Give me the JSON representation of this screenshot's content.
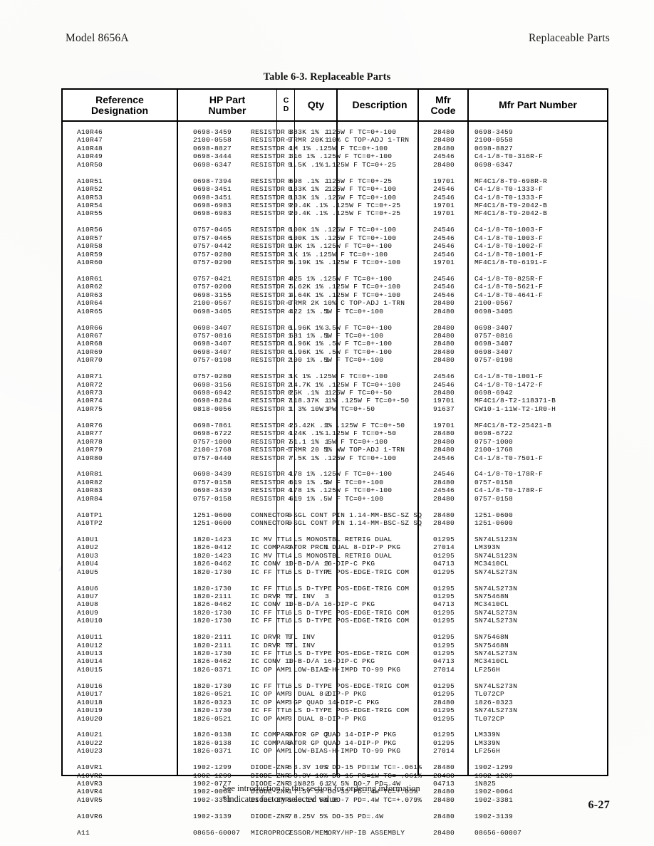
{
  "header": {
    "left": "Model 8656A",
    "right": "Replaceable Parts"
  },
  "caption": "Table 6-3. Replaceable Parts",
  "columns": {
    "reference": "Reference\nDesignation",
    "hp_part": "HP Part\nNumber",
    "cd": "C\nD",
    "qty": "Qty",
    "description": "Description",
    "mfr_code": "Mfr\nCode",
    "mfr_part": "Mfr Part Number"
  },
  "footnote": {
    "line1": "See introduction to this section for ordering information",
    "line2": "*Indicates factory selected value"
  },
  "page_number": "6-27",
  "watermark": "manualslib.com",
  "groups": [
    {
      "rows": [
        {
          "ref": "A10R46",
          "hp": "0698-3459",
          "cd": "8",
          "qty": "1",
          "desc": "RESISTOR 383K 1% .125W F TC=0+-100",
          "mfr": "28480",
          "mpn": "0698-3459"
        },
        {
          "ref": "A10R47",
          "hp": "2100-0558",
          "cd": "9",
          "qty": "1",
          "desc": "RESISTOR-TRMR 20K 10% C TOP-ADJ 1-TRN",
          "mfr": "28480",
          "mpn": "2100-0558"
        },
        {
          "ref": "A10R48",
          "hp": "0698-8827",
          "cd": "4",
          "qty": "",
          "desc": "RESISTOR 1M 1% .125W F TC=0+-100",
          "mfr": "28480",
          "mpn": "0698-8827"
        },
        {
          "ref": "A10R49",
          "hp": "0698-3444",
          "cd": "1",
          "qty": "",
          "desc": "RESISTOR 316 1% .125W F TC=0+-100",
          "mfr": "24546",
          "mpn": "C4-1/8-T0-316R-F"
        },
        {
          "ref": "A10R50",
          "hp": "0698-6347",
          "cd": "9",
          "qty": "1",
          "desc": "RESISTOR 1.5K .1% .125W F TC=0+-25",
          "mfr": "28480",
          "mpn": "0698-6347"
        }
      ]
    },
    {
      "rows": [
        {
          "ref": "A10R51",
          "hp": "0698-7394",
          "cd": "8",
          "qty": "1",
          "desc": "RESISTOR 698 .1% .125W F TC=0+-25",
          "mfr": "19701",
          "mpn": "MF4C1/8-T9-698R-R"
        },
        {
          "ref": "A10R52",
          "hp": "0698-3451",
          "cd": "0",
          "qty": "2",
          "desc": "RESISTOR 133K 1% .125W F TC=0+-100",
          "mfr": "24546",
          "mpn": "C4-1/8-T0-1333-F"
        },
        {
          "ref": "A10R53",
          "hp": "0698-3451",
          "cd": "0",
          "qty": "",
          "desc": "RESISTOR 133K 1% .125W F TC=0+-100",
          "mfr": "24546",
          "mpn": "C4-1/8-T0-1333-F"
        },
        {
          "ref": "A10R54",
          "hp": "0698-6983",
          "cd": "9",
          "qty": "",
          "desc": "RESISTOR 20.4K .1% .125W F TC=0+-25",
          "mfr": "19701",
          "mpn": "MF4C1/8-T9-2042-B"
        },
        {
          "ref": "A10R55",
          "hp": "0698-6983",
          "cd": "9",
          "qty": "",
          "desc": "RESISTOR 20.4K .1% .125W F TC=0+-25",
          "mfr": "19701",
          "mpn": "MF4C1/8-T9-2042-B"
        }
      ]
    },
    {
      "rows": [
        {
          "ref": "A10R56",
          "hp": "0757-0465",
          "cd": "6",
          "qty": "",
          "desc": "RESISTOR 100K 1% .125W F TC=0+-100",
          "mfr": "24546",
          "mpn": "C4-1/8-T0-1003-F"
        },
        {
          "ref": "A10R57",
          "hp": "0757-0465",
          "cd": "6",
          "qty": "",
          "desc": "RESISTOR 100K 1% .125W F TC=0+-100",
          "mfr": "24546",
          "mpn": "C4-1/8-T0-1003-F"
        },
        {
          "ref": "A10R58",
          "hp": "0757-0442",
          "cd": "9",
          "qty": "",
          "desc": "RESISTOR 10K 1% .125W F TC=0+-100",
          "mfr": "24546",
          "mpn": "C4-1/8-T0-1002-F"
        },
        {
          "ref": "A10R59",
          "hp": "0757-0280",
          "cd": "3",
          "qty": "",
          "desc": "RESISTOR 1K 1% .125W F TC=0+-100",
          "mfr": "24546",
          "mpn": "C4-1/8-T0-1001-F"
        },
        {
          "ref": "A10R60",
          "hp": "0757-0290",
          "cd": "5",
          "qty": "",
          "desc": "RESISTOR 6.19K 1% .125W F TC=0+-100",
          "mfr": "19701",
          "mpn": "MF4C1/8-T0-6191-F"
        }
      ]
    },
    {
      "rows": [
        {
          "ref": "A10R61",
          "hp": "0757-0421",
          "cd": "4",
          "qty": "",
          "desc": "RESISTOR 825 1% .125W F TC=0+-100",
          "mfr": "24546",
          "mpn": "C4-1/8-T0-825R-F"
        },
        {
          "ref": "A10R62",
          "hp": "0757-0200",
          "cd": "7",
          "qty": "",
          "desc": "RESISTOR 5.62K 1% .125W F TC=0+-100",
          "mfr": "24546",
          "mpn": "C4-1/8-T0-5621-F"
        },
        {
          "ref": "A10R63",
          "hp": "0698-3155",
          "cd": "1",
          "qty": "",
          "desc": "RESISTOR 4.64K 1% .125W F TC=0+-100",
          "mfr": "24546",
          "mpn": "C4-1/8-T0-4641-F"
        },
        {
          "ref": "A10R64",
          "hp": "2100-0567",
          "cd": "0",
          "qty": "",
          "desc": "RESISTOR-TRMR 2K 10% C TOP-ADJ 1-TRN",
          "mfr": "28480",
          "mpn": "2100-0567"
        },
        {
          "ref": "A10R65",
          "hp": "0698-3405",
          "cd": "4",
          "qty": "1",
          "desc": "RESISTOR 422 1% .5W F TC=0+-100",
          "mfr": "28480",
          "mpn": "0698-3405"
        }
      ]
    },
    {
      "rows": [
        {
          "ref": "A10R66",
          "hp": "0698-3407",
          "cd": "6",
          "qty": "3",
          "desc": "RESISTOR 1.96K 1% .5W F TC=0+-100",
          "mfr": "28480",
          "mpn": "0698-3407"
        },
        {
          "ref": "A10R67",
          "hp": "0757-0816",
          "cd": "1",
          "qty": "1",
          "desc": "RESISTOR 681 1% .5W F TC=0+-100",
          "mfr": "28480",
          "mpn": "0757-0816"
        },
        {
          "ref": "A10R68",
          "hp": "0698-3407",
          "cd": "6",
          "qty": "",
          "desc": "RESISTOR 1.96K 1% .5W F TC=0+-100",
          "mfr": "28480",
          "mpn": "0698-3407"
        },
        {
          "ref": "A10R69",
          "hp": "0698-3407",
          "cd": "6",
          "qty": "",
          "desc": "RESISTOR 1.96K 1% .5W F TC=0+-100",
          "mfr": "28480",
          "mpn": "0698-3407"
        },
        {
          "ref": "A10R70",
          "hp": "0757-0198",
          "cd": "2",
          "qty": "1",
          "desc": "RESISTOR 100 1% .5W F TC=0+-100",
          "mfr": "28480",
          "mpn": "0757-0198"
        }
      ]
    },
    {
      "rows": [
        {
          "ref": "A10R71",
          "hp": "0757-0280",
          "cd": "3",
          "qty": "",
          "desc": "RESISTOR 1K 1% .125W F TC=0+-100",
          "mfr": "24546",
          "mpn": "C4-1/8-T0-1001-F"
        },
        {
          "ref": "A10R72",
          "hp": "0698-3156",
          "cd": "2",
          "qty": "",
          "desc": "RESISTOR 14.7K 1% .125W F TC=0+-100",
          "mfr": "24546",
          "mpn": "C4-1/8-T0-1472-F"
        },
        {
          "ref": "A10R73",
          "hp": "0698-6942",
          "cd": "0",
          "qty": "1",
          "desc": "RESISTOR 25K .1% .125W F TC=0+-50",
          "mfr": "28480",
          "mpn": "0698-6942"
        },
        {
          "ref": "A10R74",
          "hp": "0698-8284",
          "cd": "7",
          "qty": "1",
          "desc": "RESISTOR 118.37K .1% .125W F TC=0+-50",
          "mfr": "19701",
          "mpn": "MF4C1/8-T2-118371-B"
        },
        {
          "ref": "A10R75",
          "hp": "0818-0056",
          "cd": "1",
          "qty": "1",
          "desc": "RESISTOR 1 3% 10W PW TC=0+-50",
          "mfr": "91637",
          "mpn": "CW10-1-11W-T2-1R0-H"
        }
      ]
    },
    {
      "rows": [
        {
          "ref": "A10R76",
          "hp": "0698-7861",
          "cd": "4",
          "qty": "1",
          "desc": "RESISTOR 25.42K .1% .125W F TC=0+-50",
          "mfr": "19701",
          "mpn": "MF4C1/8-T2-25421-B"
        },
        {
          "ref": "A10R77",
          "hp": "0698-6722",
          "cd": "4",
          "qty": "1",
          "desc": "RESISTOR 124K .1% .125W F TC=0+-50",
          "mfr": "28480",
          "mpn": "0698-6722"
        },
        {
          "ref": "A10R78",
          "hp": "0757-1000",
          "cd": "7",
          "qty": "1",
          "desc": "RESISTOR 51.1 1% .5W F TC=0+-100",
          "mfr": "28480",
          "mpn": "0757-1000"
        },
        {
          "ref": "A10R79",
          "hp": "2100-1768",
          "cd": "5",
          "qty": "1",
          "desc": "RESISTOR-TRMR 20 5% WW TOP-ADJ 1-TRN",
          "mfr": "28480",
          "mpn": "2100-1768"
        },
        {
          "ref": "A10R80",
          "hp": "0757-0440",
          "cd": "7",
          "qty": "",
          "desc": "RESISTOR 7.5K 1% .125W F TC=0+-100",
          "mfr": "24546",
          "mpn": "C4-1/8-T0-7501-F"
        }
      ]
    },
    {
      "rows": [
        {
          "ref": "A10R81",
          "hp": "0698-3439",
          "cd": "4",
          "qty": "",
          "desc": "RESISTOR 178 1% .125W F TC=0+-100",
          "mfr": "24546",
          "mpn": "C4-1/8-T0-178R-F"
        },
        {
          "ref": "A10R82",
          "hp": "0757-0158",
          "cd": "4",
          "qty": "2",
          "desc": "RESISTOR 619 1% .5W F TC=0+-100",
          "mfr": "28480",
          "mpn": "0757-0158"
        },
        {
          "ref": "A10R83",
          "hp": "0698-3439",
          "cd": "4",
          "qty": "",
          "desc": "RESISTOR 178 1% .125W F TC=0+-100",
          "mfr": "24546",
          "mpn": "C4-1/8-T0-178R-F"
        },
        {
          "ref": "A10R84",
          "hp": "0757-0158",
          "cd": "4",
          "qty": "",
          "desc": "RESISTOR 619 1% .5W F TC=0+-100",
          "mfr": "28480",
          "mpn": "0757-0158"
        }
      ]
    },
    {
      "rows": [
        {
          "ref": "A10TP1",
          "hp": "1251-0600",
          "cd": "0",
          "qty": "",
          "desc": "CONNECTOR-SGL CONT PIN 1.14-MM-BSC-SZ SQ",
          "mfr": "28480",
          "mpn": "1251-0600"
        },
        {
          "ref": "A10TP2",
          "hp": "1251-0600",
          "cd": "0",
          "qty": "",
          "desc": "CONNECTOR-SGL CONT PIN 1.14-MM-BSC-SZ SQ",
          "mfr": "28480",
          "mpn": "1251-0600"
        }
      ]
    },
    {
      "rows": [
        {
          "ref": "A10U1",
          "hp": "1820-1423",
          "cd": "4",
          "qty": "",
          "desc": "IC MV TTL LS MONOSTBL RETRIG DUAL",
          "mfr": "01295",
          "mpn": "SN74LS123N"
        },
        {
          "ref": "A10U2",
          "hp": "1826-0412",
          "cd": "1",
          "qty": "1",
          "desc": "IC COMPARATOR PRCN DUAL 8-DIP-P PKG",
          "mfr": "27014",
          "mpn": "LM393N"
        },
        {
          "ref": "A10U3",
          "hp": "1820-1423",
          "cd": "4",
          "qty": "",
          "desc": "IC MV TTL LS MONOSTBL RETRIG DUAL",
          "mfr": "01295",
          "mpn": "SN74LS123N"
        },
        {
          "ref": "A10U4",
          "hp": "1826-0462",
          "cd": "1",
          "qty": "3",
          "desc": "IC CONV 10-B-D/A 16-DIP-C PKG",
          "mfr": "04713",
          "mpn": "MC3410CL"
        },
        {
          "ref": "A10U5",
          "hp": "1820-1730",
          "cd": "6",
          "qty": "7",
          "desc": "IC FF TTL LS D-TYPE POS-EDGE-TRIG COM",
          "mfr": "01295",
          "mpn": "SN74LS273N"
        }
      ]
    },
    {
      "rows": [
        {
          "ref": "A10U6",
          "hp": "1820-1730",
          "cd": "6",
          "qty": "",
          "desc": "IC FF TTL LS D-TYPE POS-EDGE-TRIG COM",
          "mfr": "01295",
          "mpn": "SN74LS273N"
        },
        {
          "ref": "A10U7",
          "hp": "1820-2111",
          "cd": "9",
          "qty": "3",
          "desc": "IC DRVR TTL INV",
          "mfr": "01295",
          "mpn": "SN75468N"
        },
        {
          "ref": "A10U8",
          "hp": "1826-0462",
          "cd": "1",
          "qty": "",
          "desc": "IC CONV 10-B-D/A 16-DIP-C PKG",
          "mfr": "04713",
          "mpn": "MC3410CL"
        },
        {
          "ref": "A10U9",
          "hp": "1820-1730",
          "cd": "6",
          "qty": "",
          "desc": "IC FF TTL LS D-TYPE POS-EDGE-TRIG COM",
          "mfr": "01295",
          "mpn": "SN74LS273N"
        },
        {
          "ref": "A10U10",
          "hp": "1820-1730",
          "cd": "6",
          "qty": "",
          "desc": "IC FF TTL LS D-TYPE POS-EDGE-TRIG COM",
          "mfr": "01295",
          "mpn": "SN74LS273N"
        }
      ]
    },
    {
      "rows": [
        {
          "ref": "A10U11",
          "hp": "1820-2111",
          "cd": "9",
          "qty": "",
          "desc": "IC DRVR TTL INV",
          "mfr": "01295",
          "mpn": "SN75468N"
        },
        {
          "ref": "A10U12",
          "hp": "1820-2111",
          "cd": "9",
          "qty": "",
          "desc": "IC DRVR TTL INV",
          "mfr": "01295",
          "mpn": "SN75468N"
        },
        {
          "ref": "A10U13",
          "hp": "1820-1730",
          "cd": "6",
          "qty": "",
          "desc": "IC FF TTL LS D-TYPE POS-EDGE-TRIG COM",
          "mfr": "01295",
          "mpn": "SN74LS273N"
        },
        {
          "ref": "A10U14",
          "hp": "1826-0462",
          "cd": "1",
          "qty": "",
          "desc": "IC CONV 10-B-D/A 16-DIP-C PKG",
          "mfr": "04713",
          "mpn": "MC3410CL"
        },
        {
          "ref": "A10U15",
          "hp": "1826-0371",
          "cd": "1",
          "qty": "2",
          "desc": "IC OP AMP LOW-BIAS-H-IMPD TO-99 PKG",
          "mfr": "27014",
          "mpn": "LF256H"
        }
      ]
    },
    {
      "rows": [
        {
          "ref": "A10U16",
          "hp": "1820-1730",
          "cd": "6",
          "qty": "",
          "desc": "IC FF TTL LS D-TYPE POS-EDGE-TRIG COM",
          "mfr": "01295",
          "mpn": "SN74LS273N"
        },
        {
          "ref": "A10U17",
          "hp": "1826-0521",
          "cd": "3",
          "qty": "2",
          "desc": "IC OP AMP  DUAL 8-DIP-P PKG",
          "mfr": "01295",
          "mpn": "TL072CP"
        },
        {
          "ref": "A10U18",
          "hp": "1826-0323",
          "cd": "3",
          "qty": "",
          "desc": "IC OP AMP GP QUAD 14-DIP-C PKG",
          "mfr": "28480",
          "mpn": "1826-0323"
        },
        {
          "ref": "A10U19",
          "hp": "1820-1730",
          "cd": "6",
          "qty": "",
          "desc": "IC FF TTL LS D-TYPE POS-EDGE-TRIG COM",
          "mfr": "01295",
          "mpn": "SN74LS273N"
        },
        {
          "ref": "A10U20",
          "hp": "1826-0521",
          "cd": "3",
          "qty": "",
          "desc": "IC OP AMP  DUAL 8-DIP-P PKG",
          "mfr": "01295",
          "mpn": "TL072CP"
        }
      ]
    },
    {
      "rows": [
        {
          "ref": "A10U21",
          "hp": "1826-0138",
          "cd": "8",
          "qty": "2",
          "desc": "IC COMPARATOR GP QUAD 14-DIP-P PKG",
          "mfr": "01295",
          "mpn": "LM339N"
        },
        {
          "ref": "A10U22",
          "hp": "1826-0138",
          "cd": "8",
          "qty": "",
          "desc": "IC COMPARATOR GP QUAD 14-DIP-P PKG",
          "mfr": "01295",
          "mpn": "LM339N"
        },
        {
          "ref": "A10U23",
          "hp": "1826-0371",
          "cd": "1",
          "qty": "",
          "desc": "IC OP AMP LOW-BIAS-H-IMPD TO-99 PKG",
          "mfr": "27014",
          "mpn": "LF256H"
        }
      ]
    },
    {
      "rows": [
        {
          "ref": "A10VR1",
          "hp": "1902-1299",
          "cd": "6",
          "qty": "2",
          "desc": "DIODE-ZNR 3.3V 10% DO-15 PD=1W TC=-.061%",
          "mfr": "28480",
          "mpn": "1902-1299"
        },
        {
          "ref": "A10VR2",
          "hp": "1902-1299",
          "cd": "6",
          "qty": "",
          "desc": "DIODE-ZNR 3.3V 10% DO-15 PD=1W TC=-.061%",
          "mfr": "28480",
          "mpn": "1902-1299"
        },
        {
          "ref": "A10VR3",
          "hp": "1902-0777",
          "cd": "3",
          "qty": "1",
          "desc": "DIODE-ZNR 1N825 6.2V 5% DO-7 PD=.4W",
          "mfr": "04713",
          "mpn": "1N825"
        },
        {
          "ref": "A10VR4",
          "hp": "1902-0064",
          "cd": "1",
          "qty": "",
          "desc": "DIODE-ZNR 7.5V 5% DO-35 PD=.4W TC=+.05%",
          "mfr": "28480",
          "mpn": "1902-0064"
        },
        {
          "ref": "A10VR5",
          "hp": "1902-3381",
          "cd": "1",
          "qty": "1",
          "desc": "DIODE-ZNR 68.1V 5% DO-7 PD=.4W TC=+.079%",
          "mfr": "28480",
          "mpn": "1902-3381"
        }
      ]
    },
    {
      "rows": [
        {
          "ref": "A10VR6",
          "hp": "1902-3139",
          "cd": "7",
          "qty": "",
          "desc": "DIODE-ZNR 8.25V 5% DO-35 PD=.4W",
          "mfr": "28480",
          "mpn": "1902-3139"
        }
      ]
    },
    {
      "rows": [
        {
          "ref": "A11",
          "hp": "08656-60007",
          "cd": "7",
          "qty": "1",
          "desc": "MICROPROCESSOR/MEMORY/HP-IB ASSEMBLY",
          "mfr": "28480",
          "mpn": "08656-60007"
        }
      ]
    }
  ]
}
